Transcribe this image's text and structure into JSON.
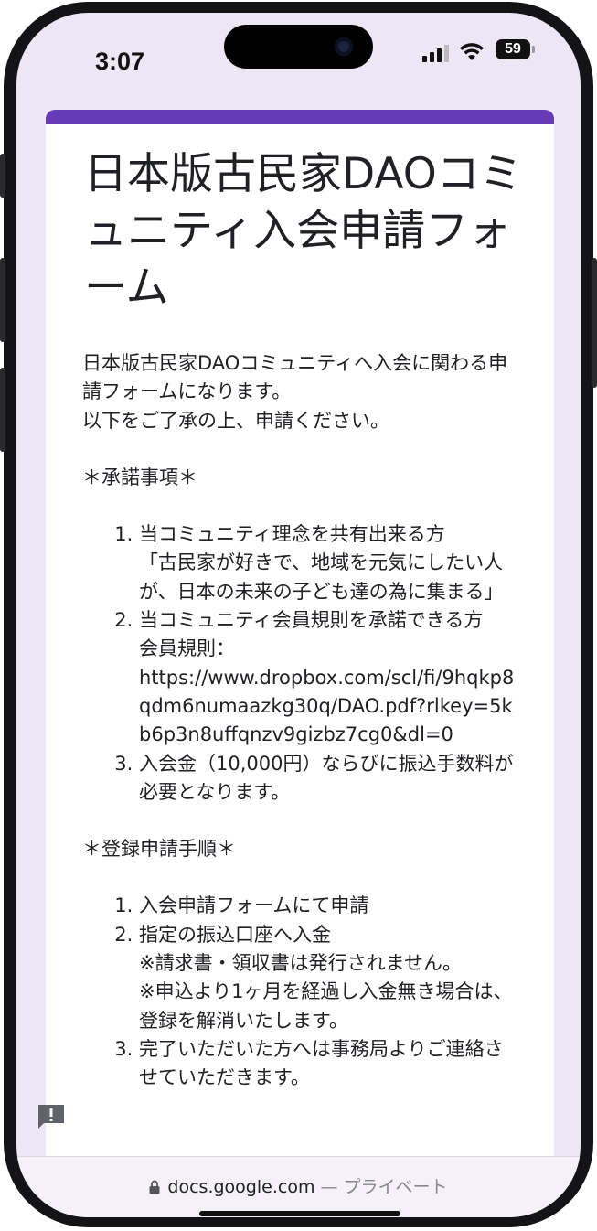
{
  "status_bar": {
    "time": "3:07",
    "battery": "59",
    "icons": [
      "signal-icon",
      "wifi-icon",
      "battery-icon"
    ]
  },
  "form": {
    "accent_color": "#673ab7",
    "title": "日本版古民家DAOコミュニティ入会申請フォーム",
    "intro": [
      "日本版古民家DAOコミュニティへ入会に関わる申請フォームになります。",
      "以下をご了承の上、申請ください。"
    ],
    "consent_heading": "＊承諾事項＊",
    "consent_items": [
      {
        "lines": [
          "当コミュニティ理念を共有出来る方",
          "「古民家が好きで、地域を元気にしたい人が、日本の未来の子ども達の為に集まる」"
        ]
      },
      {
        "lines": [
          "当コミュニティ会員規則を承諾できる方",
          "会員規則：",
          "https://www.dropbox.com/scl/fi/9hqkp8qdm6numaazkg30q/DAO.pdf?rlkey=5kb6p3n8uffqnzv9gizbz7cg0&dl=0"
        ]
      },
      {
        "lines": [
          "入会金（10,000円）ならびに振込手数料が必要となります。"
        ]
      }
    ],
    "procedure_heading": "＊登録申請手順＊",
    "procedure_items": [
      {
        "lines": [
          "入会申請フォームにて申請"
        ]
      },
      {
        "lines": [
          "指定の振込口座へ入金",
          "※請求書・領収書は発行されません。",
          "※申込より1ヶ月を経過し入金無き場合は、登録を解消いたします。"
        ]
      },
      {
        "lines": [
          "完了いただいた方へは事務局よりご連絡させていただきます。"
        ]
      }
    ]
  },
  "url_bar": {
    "domain": "docs.google.com",
    "separator": " — ",
    "privacy": "プライベート"
  },
  "feedback": {
    "icon": "feedback-icon"
  }
}
